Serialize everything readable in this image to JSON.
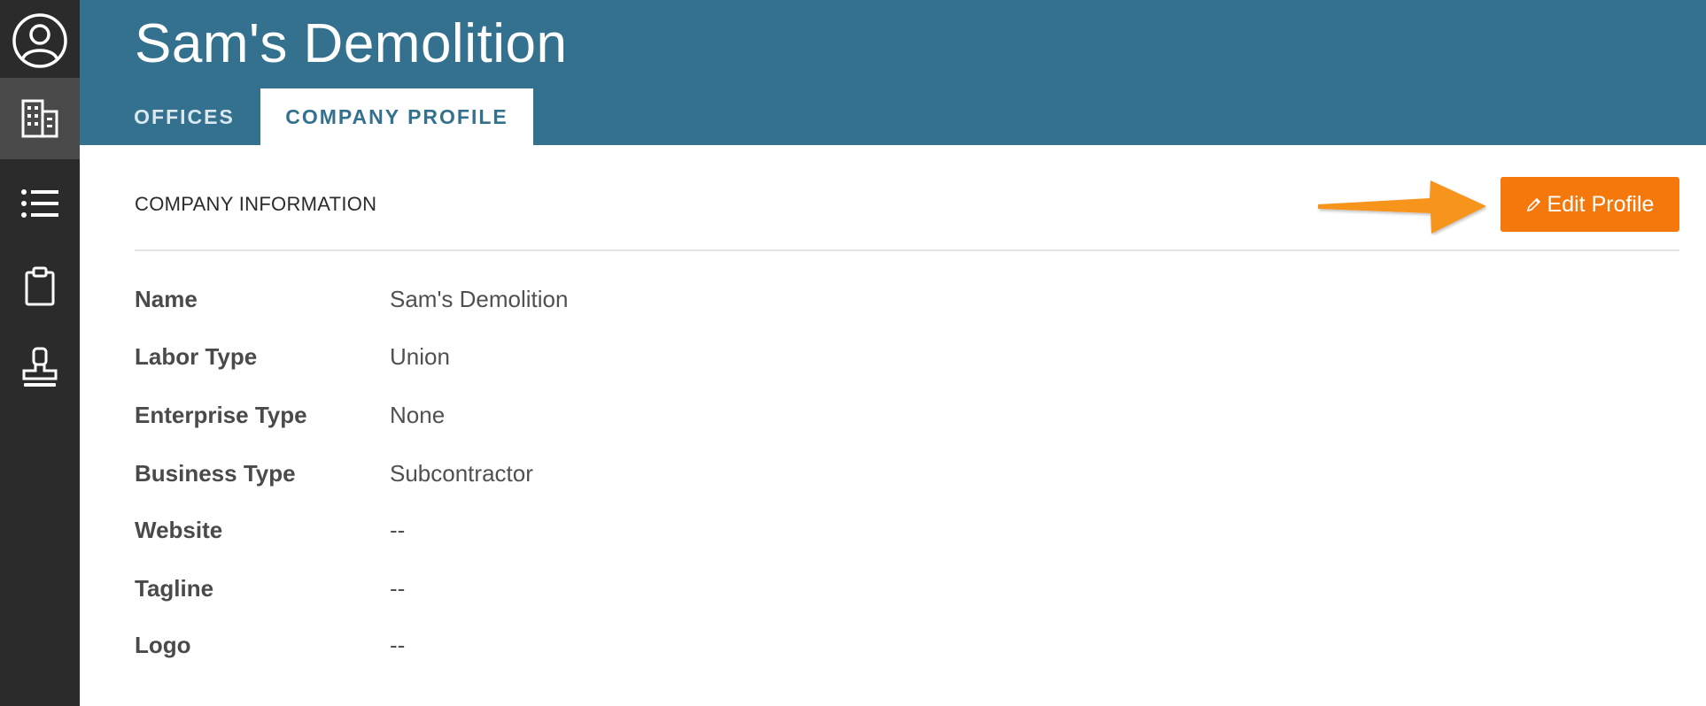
{
  "rail": {
    "items": [
      {
        "icon": "user-circle-icon"
      },
      {
        "icon": "building-icon"
      },
      {
        "icon": "list-icon"
      },
      {
        "icon": "clipboard-icon"
      },
      {
        "icon": "stamp-icon"
      }
    ]
  },
  "header": {
    "title": "Sam's Demolition",
    "tabs": [
      {
        "label": "OFFICES"
      },
      {
        "label": "COMPANY PROFILE",
        "active": true
      }
    ]
  },
  "section": {
    "title": "COMPANY INFORMATION",
    "edit_label": "Edit Profile"
  },
  "fields": [
    {
      "label": "Name",
      "value": "Sam's Demolition"
    },
    {
      "label": "Labor Type",
      "value": "Union"
    },
    {
      "label": "Enterprise Type",
      "value": "None"
    },
    {
      "label": "Business Type",
      "value": "Subcontractor"
    },
    {
      "label": "Website",
      "value": "--"
    },
    {
      "label": "Tagline",
      "value": "--"
    },
    {
      "label": "Logo",
      "value": "--"
    }
  ],
  "colors": {
    "header": "#33718f",
    "rail": "#2b2b2b",
    "accent": "#f5780d",
    "annotation_arrow": "#f7941d"
  }
}
